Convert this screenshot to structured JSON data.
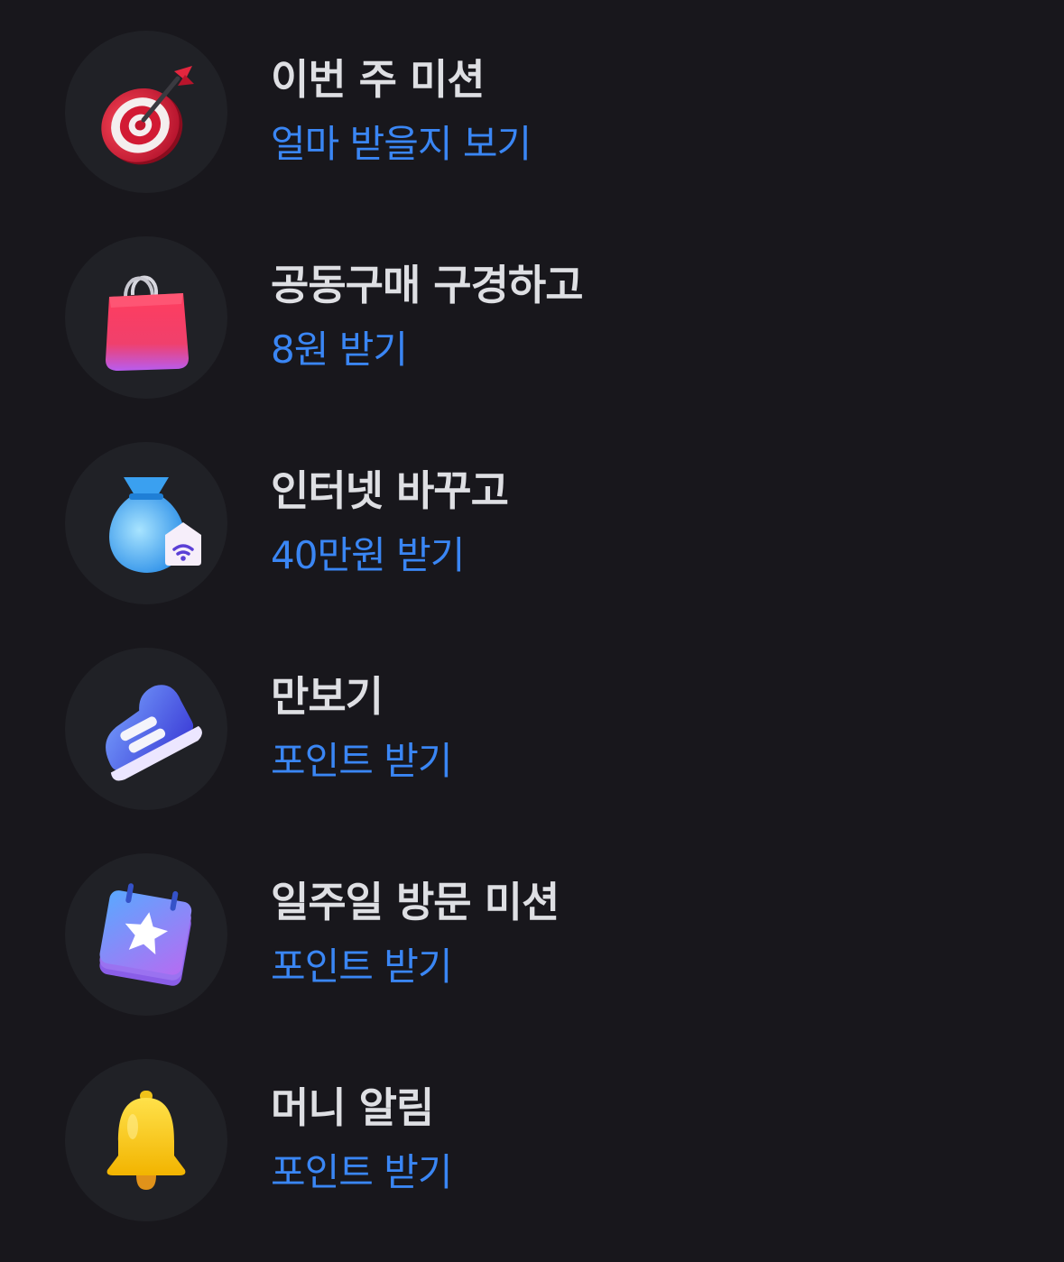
{
  "missions": [
    {
      "title": "이번 주 미션",
      "subtitle": "얼마 받을지 보기",
      "icon": "target-dart-icon"
    },
    {
      "title": "공동구매 구경하고",
      "subtitle": "8원 받기",
      "icon": "shopping-bag-icon"
    },
    {
      "title": "인터넷 바꾸고",
      "subtitle": "40만원 받기",
      "icon": "money-bag-wifi-icon"
    },
    {
      "title": "만보기",
      "subtitle": "포인트 받기",
      "icon": "sneaker-icon"
    },
    {
      "title": "일주일 방문 미션",
      "subtitle": "포인트 받기",
      "icon": "calendar-star-icon"
    },
    {
      "title": "머니 알림",
      "subtitle": "포인트 받기",
      "icon": "bell-icon"
    }
  ],
  "colors": {
    "background": "#18171c",
    "icon_circle": "#202126",
    "title": "#dedfe3",
    "accent": "#3a86f4"
  }
}
